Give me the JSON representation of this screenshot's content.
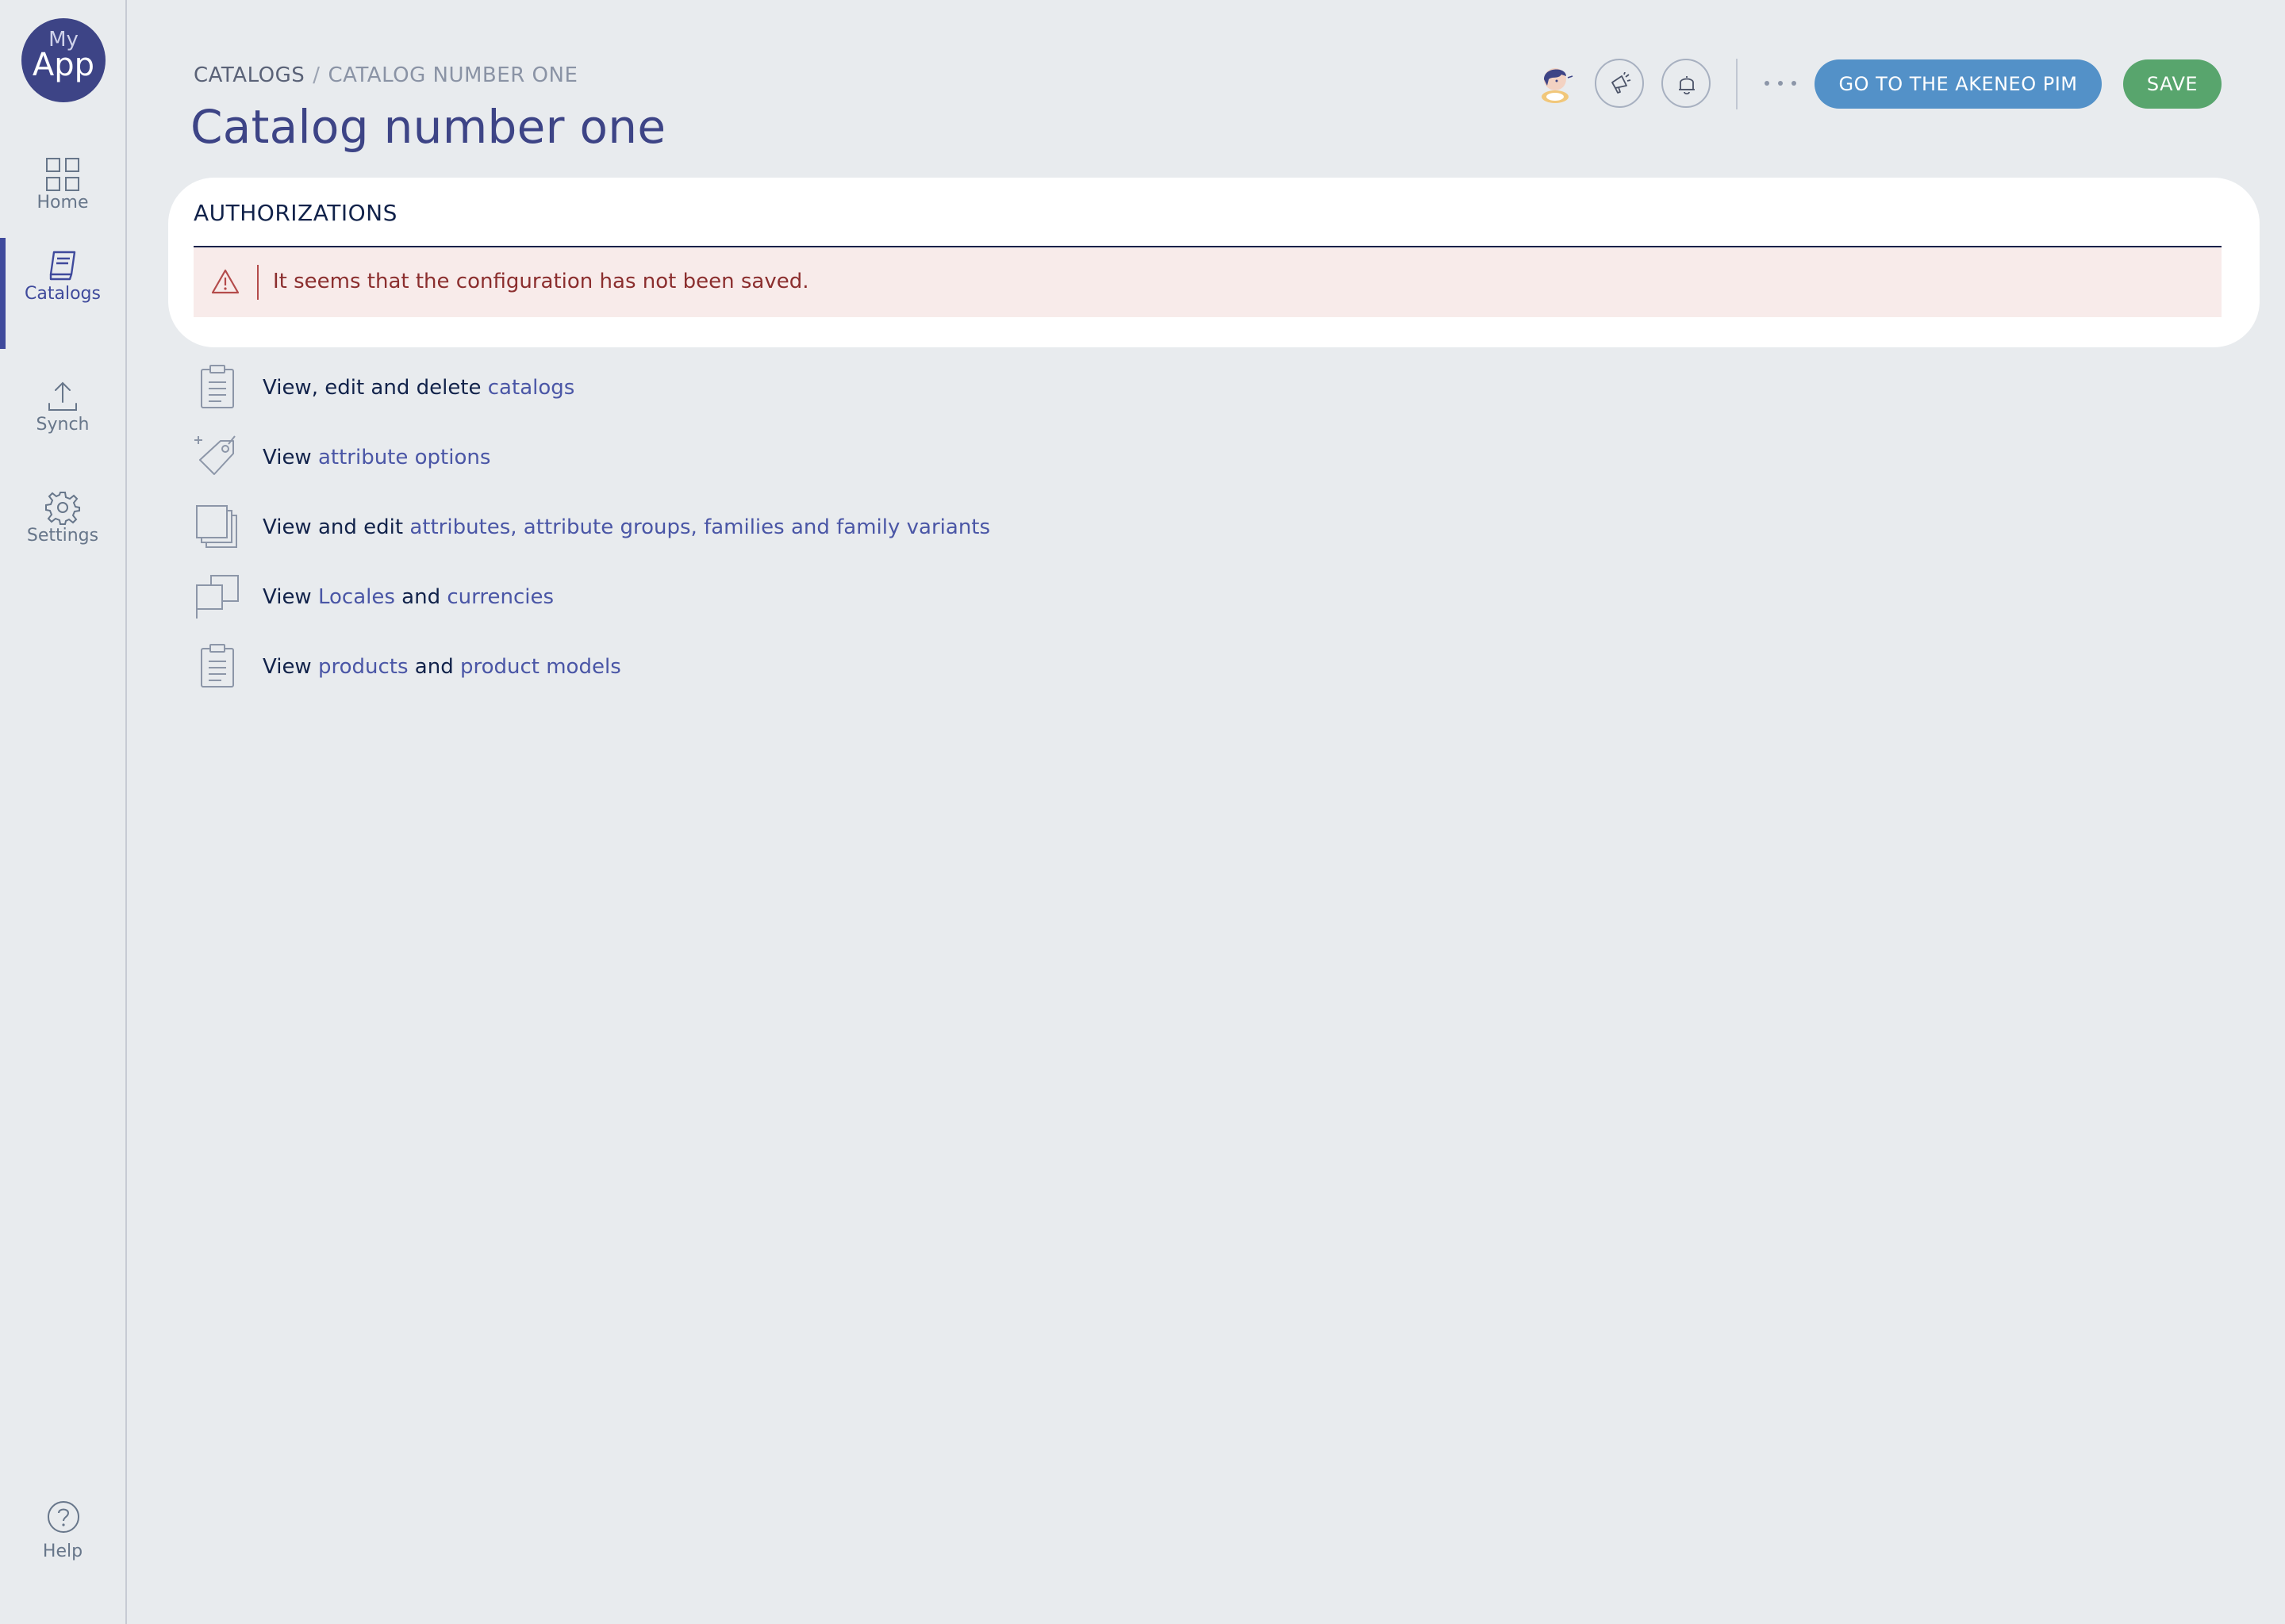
{
  "app": {
    "logo_top": "My",
    "logo_main": "App"
  },
  "sidebar": {
    "items": [
      {
        "label": "Home",
        "icon": "grid-icon"
      },
      {
        "label": "Catalogs",
        "icon": "book-icon",
        "active": true
      },
      {
        "label": "Synch",
        "icon": "upload-icon"
      },
      {
        "label": "Settings",
        "icon": "gear-icon"
      }
    ],
    "help": {
      "label": "Help",
      "icon": "question-icon"
    }
  },
  "header": {
    "breadcrumb": {
      "root": "CATALOGS",
      "separator": "/",
      "current": "CATALOG NUMBER ONE"
    },
    "title": "Catalog number one",
    "actions": {
      "more": "more-dots-icon",
      "go_to_pim": "GO TO THE AKENEO PIM",
      "save": "SAVE"
    }
  },
  "authorizations": {
    "title": "AUTHORIZATIONS",
    "alert": "It seems that the configuration has not been saved.",
    "permissions": [
      {
        "icon": "clipboard-icon",
        "parts": [
          "View, edit and delete ",
          "catalogs"
        ]
      },
      {
        "icon": "tag-icon",
        "parts": [
          "View ",
          "attribute options"
        ]
      },
      {
        "icon": "stack-icon",
        "parts": [
          "View and edit ",
          "attributes, attribute groups, families and family variants"
        ]
      },
      {
        "icon": "flag-icon",
        "parts": [
          "View ",
          "Locales",
          " and ",
          "currencies"
        ]
      },
      {
        "icon": "clipboard-icon",
        "parts": [
          "View ",
          "products",
          " and ",
          "product models"
        ]
      }
    ]
  },
  "colors": {
    "accent": "#3d4486",
    "link": "#4a56a6",
    "primary_button": "#5391c8",
    "save_button": "#58a56d",
    "alert_bg": "#f8ebea",
    "alert_text": "#8b2e2e"
  }
}
